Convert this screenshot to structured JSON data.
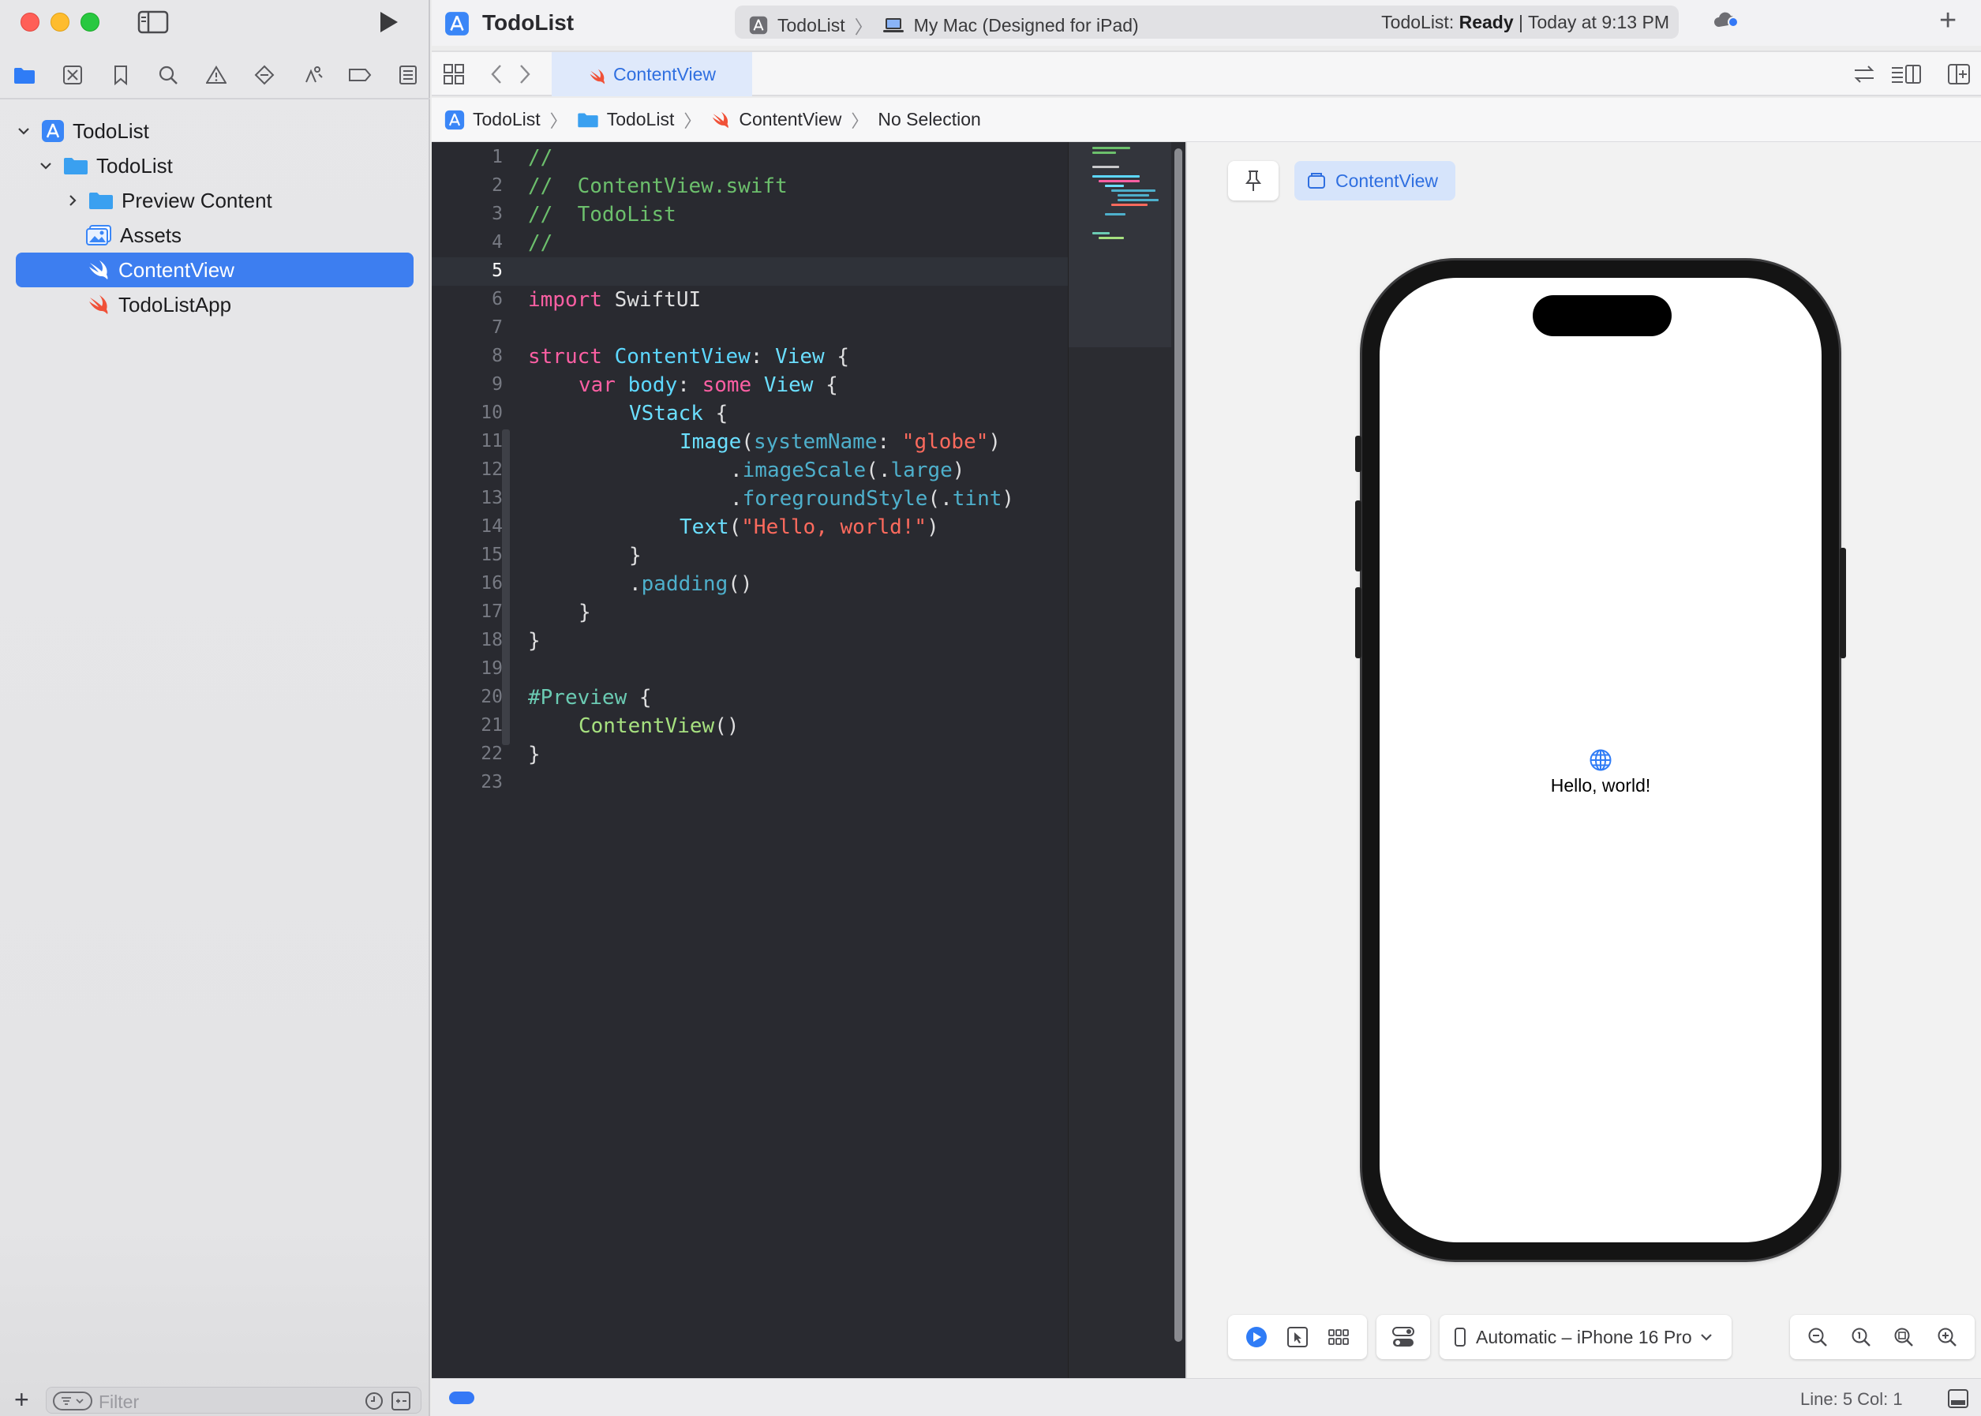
{
  "window": {
    "app_title": "TodoList",
    "scheme": "TodoList",
    "destination": "My Mac (Designed for iPad)",
    "status_project": "TodoList:",
    "status_state": "Ready",
    "status_time": "| Today at 9:13 PM"
  },
  "navigator": {
    "tree": [
      {
        "label": "TodoList",
        "icon": "project-icon",
        "level": 0,
        "expanded": true
      },
      {
        "label": "TodoList",
        "icon": "folder-icon",
        "level": 1,
        "expanded": true
      },
      {
        "label": "Preview Content",
        "icon": "folder-icon",
        "level": 2,
        "expanded": false
      },
      {
        "label": "Assets",
        "icon": "asset-catalog-icon",
        "level": 2
      },
      {
        "label": "ContentView",
        "icon": "swift-file-icon",
        "level": 2,
        "selected": true
      },
      {
        "label": "TodoListApp",
        "icon": "swift-file-icon",
        "level": 2
      }
    ],
    "filter_placeholder": "Filter"
  },
  "editor": {
    "tab_label": "ContentView",
    "breadcrumb": [
      "TodoList",
      "TodoList",
      "ContentView",
      "No Selection"
    ],
    "current_line": 5,
    "line_numbers": [
      "1",
      "2",
      "3",
      "4",
      "5",
      "6",
      "7",
      "8",
      "9",
      "10",
      "11",
      "12",
      "13",
      "14",
      "15",
      "16",
      "17",
      "18",
      "19",
      "20",
      "21",
      "22",
      "23"
    ],
    "code": {
      "l1": "//",
      "l2": "//  ContentView.swift",
      "l3": "//  TodoList",
      "l4": "//",
      "l6_kw": "import",
      "l6_mod": " SwiftUI",
      "l8_kw": "struct",
      "l8_name": " ContentView",
      "l8_colon": ": ",
      "l8_type": "View",
      "l8_brace": " {",
      "l9_kw": "var",
      "l9_name": " body",
      "l9_colon": ": ",
      "l9_some": "some",
      "l9_sp": " ",
      "l9_type": "View",
      "l9_brace": " {",
      "l10_type": "VStack",
      "l10_brace": " {",
      "l11_type": "Image",
      "l11_paren": "(",
      "l11_arg": "systemName",
      "l11_colon": ": ",
      "l11_str": "\"globe\"",
      "l11_close": ")",
      "l12_dot": ".",
      "l12_fn": "imageScale",
      "l12_p": "(.",
      "l12_arg": "large",
      "l12_close": ")",
      "l13_dot": ".",
      "l13_fn": "foregroundStyle",
      "l13_p": "(.",
      "l13_arg": "tint",
      "l13_close": ")",
      "l14_type": "Text",
      "l14_paren": "(",
      "l14_str": "\"Hello, world!\"",
      "l14_close": ")",
      "l15": "}",
      "l16_dot": ".",
      "l16_fn": "padding",
      "l16_close": "()",
      "l17": "}",
      "l18": "}",
      "l20_macro": "#Preview",
      "l20_brace": " {",
      "l21_call": "ContentView",
      "l21_close": "()",
      "l22": "}"
    }
  },
  "canvas": {
    "preview_chip": "ContentView",
    "preview_text": "Hello, world!",
    "device_picker": "Automatic – iPhone 16 Pro"
  },
  "statusbar": {
    "position": "Line: 5  Col: 1"
  },
  "colors": {
    "accent": "#3d7ef0",
    "editor_bg": "#292a30",
    "swift_orange": "#f05138",
    "folder_blue": "#3aa0f0"
  }
}
